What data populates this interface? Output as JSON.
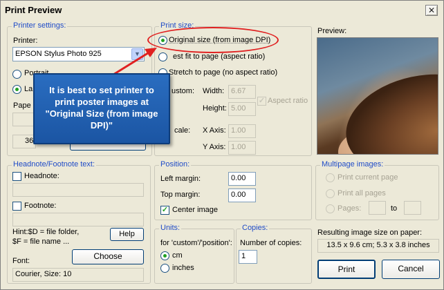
{
  "window": {
    "title": "Print Preview",
    "close_glyph": "✕"
  },
  "printer_settings": {
    "legend": "Printer settings:",
    "printer_label": "Printer:",
    "printer_value": "EPSON Stylus Photo 925",
    "portrait": "Portrait",
    "landscape_partial": "La",
    "paper_partial": "Pape",
    "num_partial": "36"
  },
  "print_size": {
    "legend": "Print size:",
    "original": "Original size (from image DPI)",
    "best_fit_partial": "est fit to page (aspect ratio)",
    "stretch": "Stretch to page (no aspect ratio)",
    "custom_partial": "ustom:",
    "width_label": "Width:",
    "width_value": "6.67",
    "height_label": "Height:",
    "height_value": "5.00",
    "aspect_ratio": "Aspect ratio",
    "scale_partial": "cale:",
    "x_axis_label": "X Axis:",
    "x_axis_value": "1.00",
    "y_axis_label": "Y Axis:",
    "y_axis_value": "1.00"
  },
  "preview": {
    "label": "Preview:"
  },
  "callout": {
    "text": "It is best to set printer to print poster images at \"Original Size (from image DPI)\""
  },
  "headnote": {
    "legend": "Headnote/Footnote text:",
    "headnote_label": "Headnote:",
    "footnote_label": "Footnote:",
    "hint_line1": "Hint:$D = file folder,",
    "hint_line2": "$F = file name ...",
    "help_button": "Help",
    "font_label": "Font:",
    "choose_button": "Choose",
    "font_value": "Courier, Size: 10"
  },
  "position": {
    "legend": "Position:",
    "left_margin_label": "Left margin:",
    "left_margin_value": "0.00",
    "top_margin_label": "Top margin:",
    "top_margin_value": "0.00",
    "center_image": "Center image"
  },
  "units": {
    "legend": "Units:",
    "description": "for 'custom'/'position':",
    "cm": "cm",
    "inches": "inches"
  },
  "copies": {
    "legend": "Copies:",
    "number_label": "Number of copies:",
    "number_value": "1"
  },
  "multipage": {
    "legend": "Multipage images:",
    "print_current": "Print current page",
    "print_all": "Print all pages",
    "pages": "Pages:",
    "to": "to"
  },
  "result": {
    "label": "Resulting image size on paper:",
    "value": "13.5 x 9.6 cm; 5.3 x 3.8 inches"
  },
  "buttons": {
    "print": "Print",
    "cancel": "Cancel"
  },
  "colors": {
    "accent": "#1f4bc7",
    "annotation_red": "#e02020",
    "callout_blue": "#1d5fb0"
  }
}
